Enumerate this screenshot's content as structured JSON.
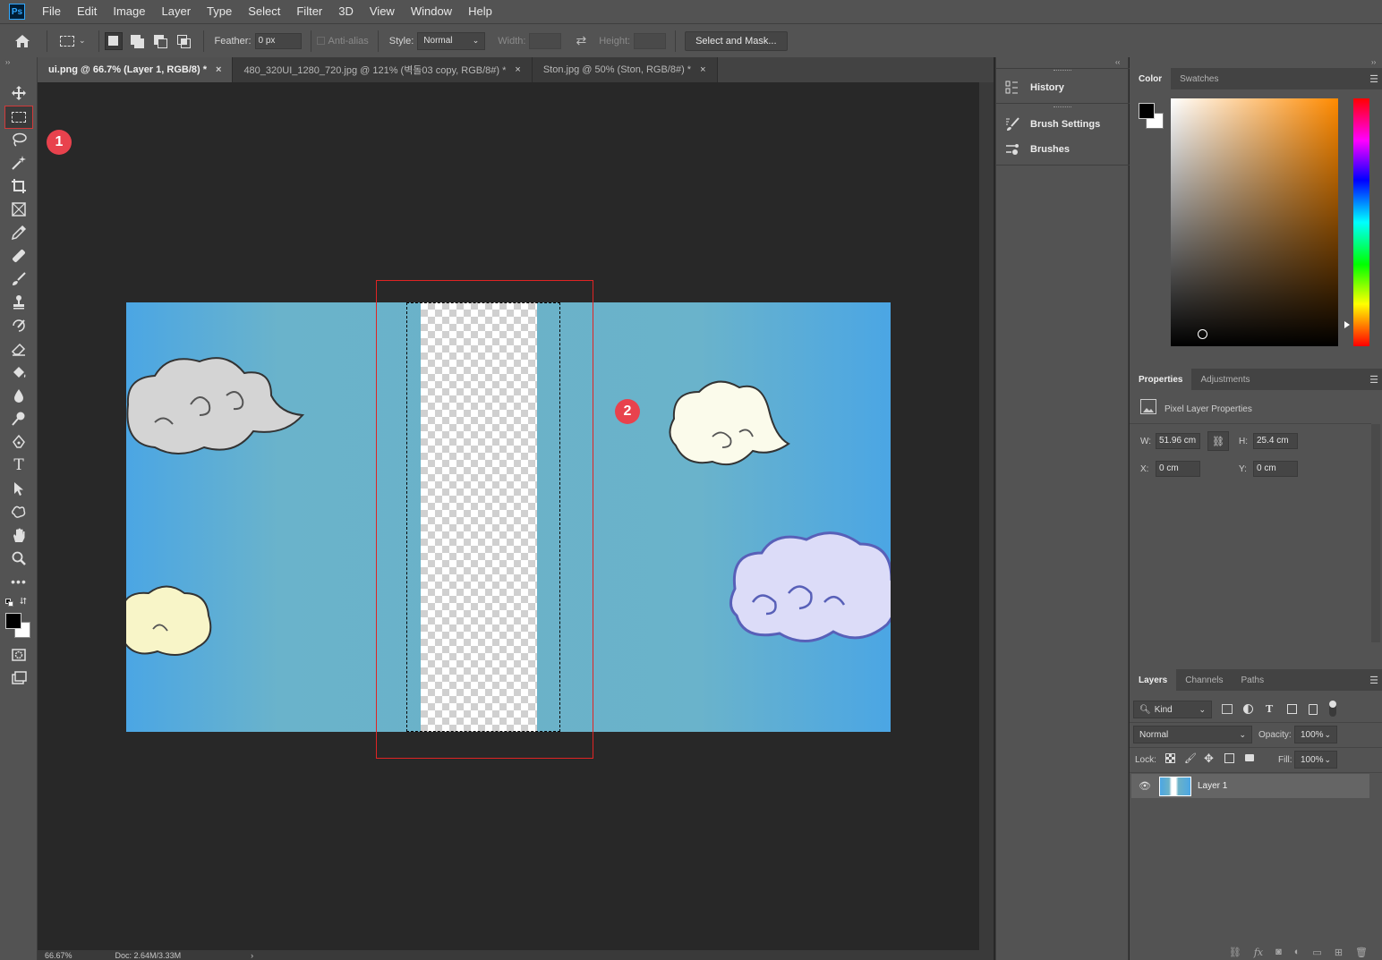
{
  "menu": {
    "logo": "Ps",
    "items": [
      "File",
      "Edit",
      "Image",
      "Layer",
      "Type",
      "Select",
      "Filter",
      "3D",
      "View",
      "Window",
      "Help"
    ]
  },
  "options": {
    "feather_label": "Feather:",
    "feather_value": "0 px",
    "antialias_label": "Anti-alias",
    "style_label": "Style:",
    "style_value": "Normal",
    "width_label": "Width:",
    "height_label": "Height:",
    "select_mask_label": "Select and Mask..."
  },
  "tabs": [
    {
      "label": "ui.png @ 66.7% (Layer 1, RGB/8) *",
      "close": "×"
    },
    {
      "label": "480_320UI_1280_720.jpg @ 121% (벽돌03 copy, RGB/8#) *",
      "close": "×"
    },
    {
      "label": "Ston.jpg @ 50% (Ston, RGB/8#) *",
      "close": "×"
    }
  ],
  "annotations": {
    "badge1": "1",
    "badge2": "2"
  },
  "status": {
    "zoom": "66.67%",
    "doc": "Doc: 2.64M/3.33M",
    "arrow": "›"
  },
  "midpanel": {
    "history": "History",
    "brush_settings": "Brush Settings",
    "brushes": "Brushes"
  },
  "color_panel": {
    "tabs": [
      "Color",
      "Swatches"
    ]
  },
  "properties": {
    "tabs": [
      "Properties",
      "Adjustments"
    ],
    "title": "Pixel Layer Properties",
    "w_label": "W:",
    "w_value": "51.96 cm",
    "h_label": "H:",
    "h_value": "25.4 cm",
    "x_label": "X:",
    "x_value": "0 cm",
    "y_label": "Y:",
    "y_value": "0 cm"
  },
  "layers": {
    "tabs": [
      "Layers",
      "Channels",
      "Paths"
    ],
    "filter_kind": "Kind",
    "blend_mode": "Normal",
    "opacity_label": "Opacity:",
    "opacity_value": "100%",
    "lock_label": "Lock:",
    "fill_label": "Fill:",
    "fill_value": "100%",
    "layer_name": "Layer 1"
  },
  "colors": {
    "accent_red": "#e8424d",
    "sky": "#4ba6e4"
  }
}
